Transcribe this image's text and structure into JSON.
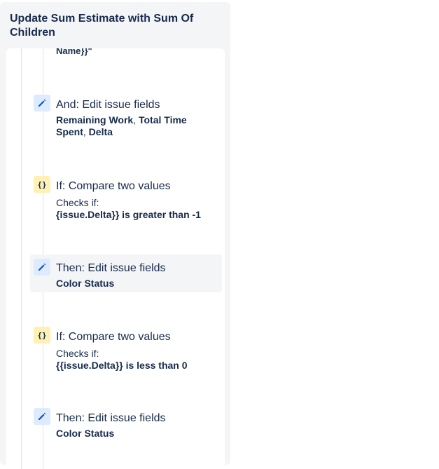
{
  "panel": {
    "title": "Update Sum Estimate with Sum Of Children"
  },
  "cut_text": "Name}}\"",
  "steps": [
    {
      "icon": "edit-pencil-icon",
      "title": "And: Edit issue fields",
      "fields": [
        "Remaining Work",
        "Total Time Spent",
        "Delta"
      ],
      "separator": ", "
    },
    {
      "icon": "condition-braces-icon",
      "icon_glyph": "{}",
      "title": "If: Compare two values",
      "subtitle": "Checks if:",
      "detail": "{issue.Delta}} is greater than -1"
    },
    {
      "icon": "edit-pencil-icon",
      "title": "Then: Edit issue fields",
      "detail": "Color Status",
      "selected": true
    },
    {
      "icon": "condition-braces-icon",
      "icon_glyph": "{}",
      "title": "If: Compare two values",
      "subtitle": "Checks if:",
      "detail": "{{issue.Delta}} is less than 0"
    },
    {
      "icon": "edit-pencil-icon",
      "title": "Then: Edit issue fields",
      "detail": "Color Status"
    }
  ],
  "colors": {
    "panel_bg": "#f4f5f7",
    "edit_icon_bg": "#deebff",
    "edit_icon_fg": "#0052cc",
    "condition_icon_bg": "#fff0b3",
    "text": "#172b4d",
    "selected_bg": "#f4f5f7"
  }
}
